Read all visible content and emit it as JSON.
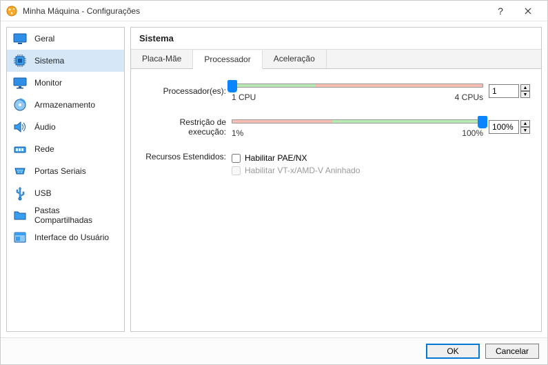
{
  "window": {
    "title": "Minha Máquina - Configurações"
  },
  "sidebar": {
    "items": [
      {
        "label": "Geral"
      },
      {
        "label": "Sistema"
      },
      {
        "label": "Monitor"
      },
      {
        "label": "Armazenamento"
      },
      {
        "label": "Áudio"
      },
      {
        "label": "Rede"
      },
      {
        "label": "Portas Seriais"
      },
      {
        "label": "USB"
      },
      {
        "label": "Pastas Compartilhadas"
      },
      {
        "label": "Interface do Usuário"
      }
    ]
  },
  "main": {
    "heading": "Sistema",
    "tabs": [
      {
        "label": "Placa-Mãe"
      },
      {
        "label": "Processador"
      },
      {
        "label": "Aceleração"
      }
    ],
    "processor": {
      "label": "Processador(es):",
      "value": "1",
      "min_label": "1 CPU",
      "max_label": "4 CPUs"
    },
    "execution_cap": {
      "label": "Restrição de execução:",
      "value": "100%",
      "min_label": "1%",
      "max_label": "100%"
    },
    "extended": {
      "label": "Recursos Estendidos:",
      "pae": "Habilitar PAE/NX",
      "nested": "Habilitar VT-x/AMD-V Aninhado"
    }
  },
  "footer": {
    "ok": "OK",
    "cancel": "Cancelar"
  }
}
